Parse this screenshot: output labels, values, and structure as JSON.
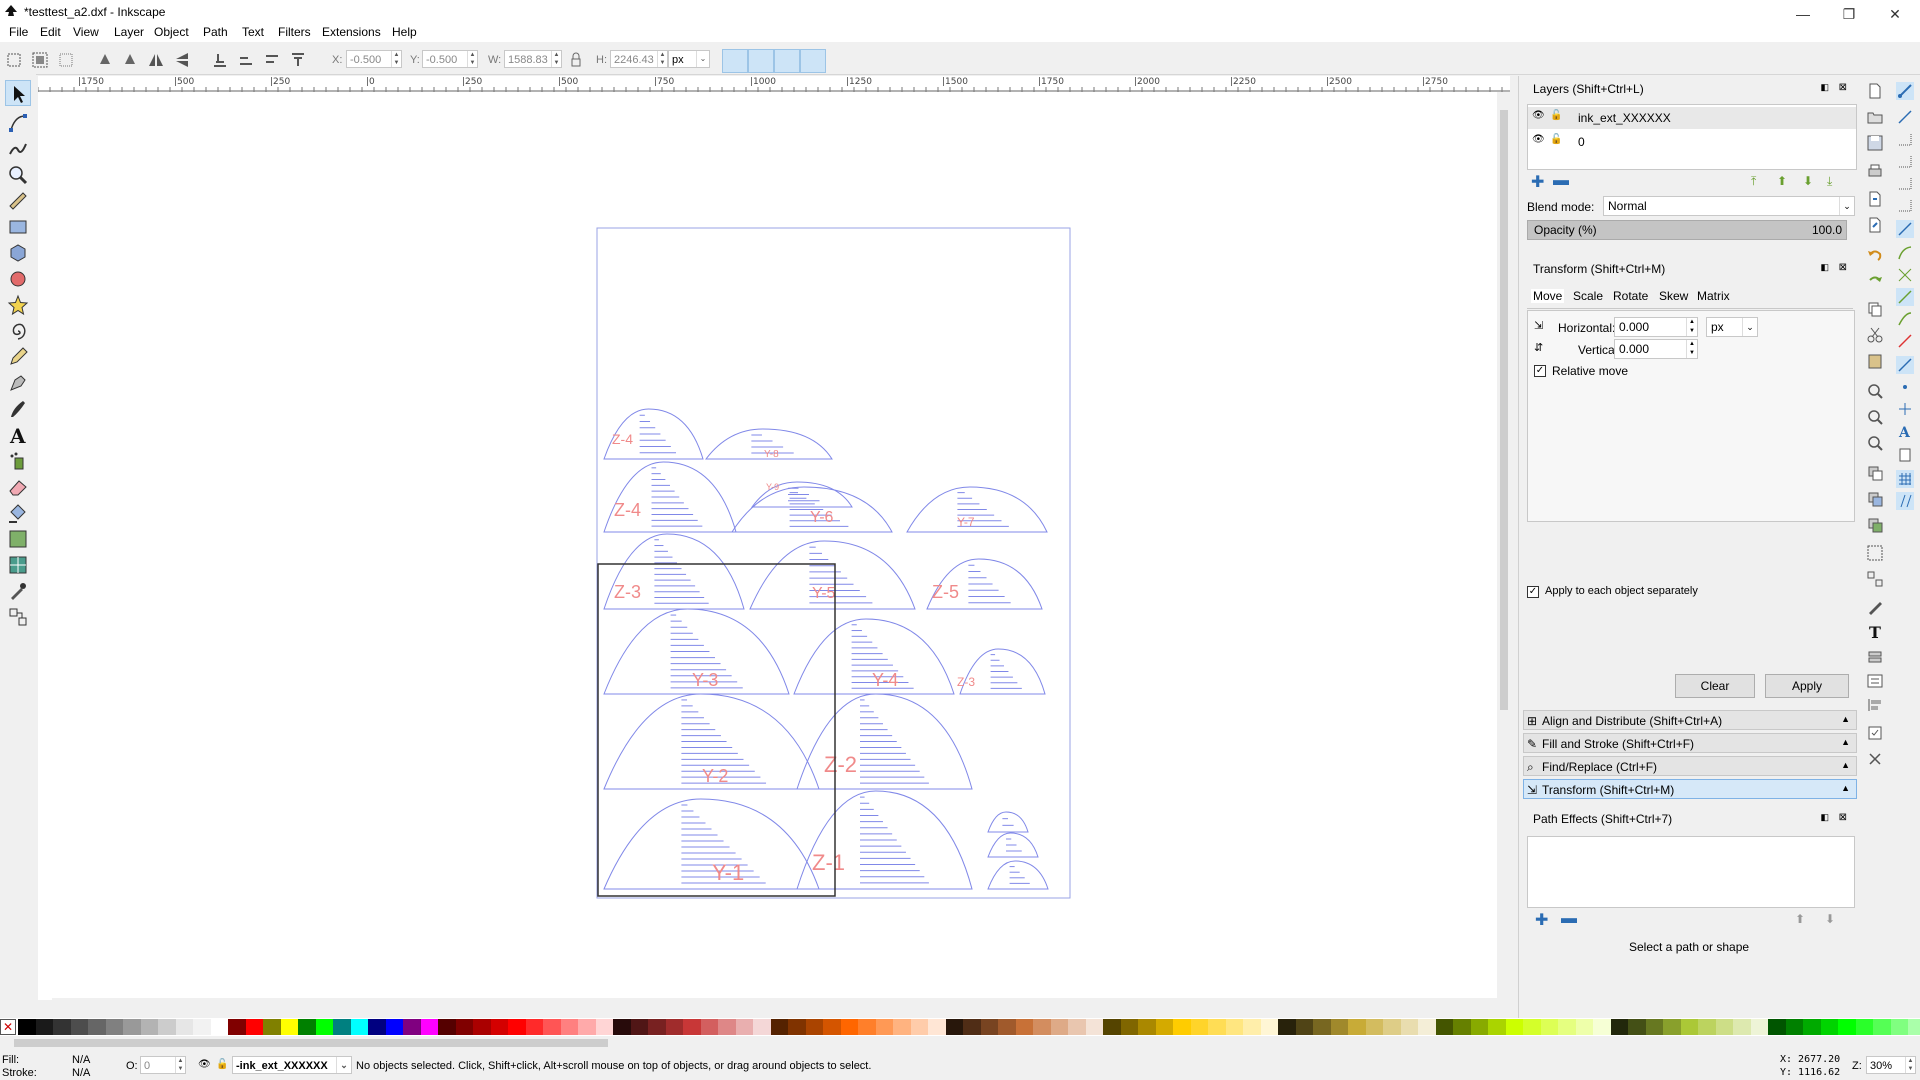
{
  "window": {
    "title": "*testtest_a2.dxf - Inkscape",
    "minimize": "—",
    "maximize": "❐",
    "close": "✕"
  },
  "menu": [
    "File",
    "Edit",
    "View",
    "Layer",
    "Object",
    "Path",
    "Text",
    "Filters",
    "Extensions",
    "Help"
  ],
  "controls": {
    "x_label": "X:",
    "x_value": "-0.500",
    "y_label": "Y:",
    "y_value": "-0.500",
    "w_label": "W:",
    "w_value": "1588.83",
    "h_label": "H:",
    "h_value": "2246.43",
    "unit": "px"
  },
  "ruler_labels": [
    "|1750",
    "|500",
    "|250",
    "|0",
    "|250",
    "|500",
    "|750",
    "|1000",
    "|1250",
    "|1500",
    "|1750",
    "|2000",
    "|2250",
    "|2500",
    "|2750"
  ],
  "drawing_labels": [
    "Z-4",
    "Y-8",
    "Z-4",
    "Y-9",
    "Y-6",
    "Y-7",
    "Z-3",
    "Y-5",
    "Z-5",
    "Y-3",
    "Y-4",
    "Z-3",
    "Y-2",
    "Z-2",
    "Y-1",
    "Z-1"
  ],
  "layers_panel": {
    "title": "Layers (Shift+Ctrl+L)",
    "layers": [
      {
        "name": "ink_ext_XXXXXX"
      },
      {
        "name": "0"
      }
    ],
    "blend_label": "Blend mode:",
    "blend_value": "Normal",
    "opacity_label": "Opacity (%)",
    "opacity_value": "100.0"
  },
  "transform_panel": {
    "title": "Transform (Shift+Ctrl+M)",
    "tabs": [
      "Move",
      "Scale",
      "Rotate",
      "Skew",
      "Matrix"
    ],
    "horizontal_label": "Horizontal:",
    "horizontal_value": "0.000",
    "vertical_label": "Vertical:",
    "vertical_value": "0.000",
    "unit": "px",
    "relative_move": "Relative move",
    "apply_each": "Apply to each object separately",
    "clear": "Clear",
    "apply": "Apply"
  },
  "collapsed_panels": [
    "Align and Distribute (Shift+Ctrl+A)",
    "Fill and Stroke (Shift+Ctrl+F)",
    "Find/Replace (Ctrl+F)",
    "Transform (Shift+Ctrl+M)"
  ],
  "path_effects": {
    "title": "Path Effects  (Shift+Ctrl+7)",
    "hint": "Select a path or shape"
  },
  "status": {
    "fill_label": "Fill:",
    "fill_value": "N/A",
    "stroke_label": "Stroke:",
    "stroke_value": "N/A",
    "opacity_label": "O:",
    "opacity_value": "0",
    "layer": "-ink_ext_XXXXXX",
    "message": "No objects selected. Click, Shift+click, Alt+scroll mouse on top of objects, or drag around objects to select.",
    "coord_x": "X: 2677.20",
    "coord_y": "Y: 1116.62",
    "zoom_label": "Z:",
    "zoom_value": "30%"
  },
  "palette": [
    "#000000",
    "#1a1a1a",
    "#333333",
    "#4d4d4d",
    "#666666",
    "#808080",
    "#999999",
    "#b3b3b3",
    "#cccccc",
    "#e6e6e6",
    "#f2f2f2",
    "#ffffff",
    "#800000",
    "#ff0000",
    "#808000",
    "#ffff00",
    "#008000",
    "#00ff00",
    "#008080",
    "#00ffff",
    "#000080",
    "#0000ff",
    "#800080",
    "#ff00ff",
    "#550000",
    "#800000",
    "#aa0000",
    "#d40000",
    "#ff0000",
    "#ff2a2a",
    "#ff5555",
    "#ff8080",
    "#ffaaaa",
    "#ffd5d5",
    "#280b0b",
    "#501616",
    "#782121",
    "#a02c2c",
    "#c83737",
    "#d35f5f",
    "#de8787",
    "#e9afaf",
    "#f4d7d7",
    "#552200",
    "#803300",
    "#aa4400",
    "#d45500",
    "#ff6600",
    "#ff7f2a",
    "#ff9955",
    "#ffb380",
    "#ffccaa",
    "#ffe6d5",
    "#28170b",
    "#502d16",
    "#784421",
    "#a05a2c",
    "#c87137",
    "#d38d5f",
    "#deaa87",
    "#e9c6af",
    "#f4e3d7",
    "#554400",
    "#806600",
    "#aa8800",
    "#d4aa00",
    "#ffcc00",
    "#ffd42a",
    "#ffdd55",
    "#ffe680",
    "#ffeeaa",
    "#fff6d5",
    "#28220b",
    "#504416",
    "#786721",
    "#a0892c",
    "#c8ab37",
    "#d3bc5f",
    "#decd87",
    "#e9ddaf",
    "#f4eed7",
    "#445500",
    "#668000",
    "#88aa00",
    "#aad400",
    "#ccff00",
    "#d4ff2a",
    "#ddff55",
    "#e5ff80",
    "#eeffaa",
    "#f6ffd5",
    "#22280b",
    "#445016",
    "#677821",
    "#89a02c",
    "#abc837",
    "#bcd35f",
    "#cdde87",
    "#dde9af",
    "#eef4d7",
    "#005500",
    "#008000",
    "#00aa00",
    "#00d400",
    "#00ff00",
    "#2aff2a",
    "#55ff55",
    "#80ff80",
    "#aaffaa"
  ]
}
